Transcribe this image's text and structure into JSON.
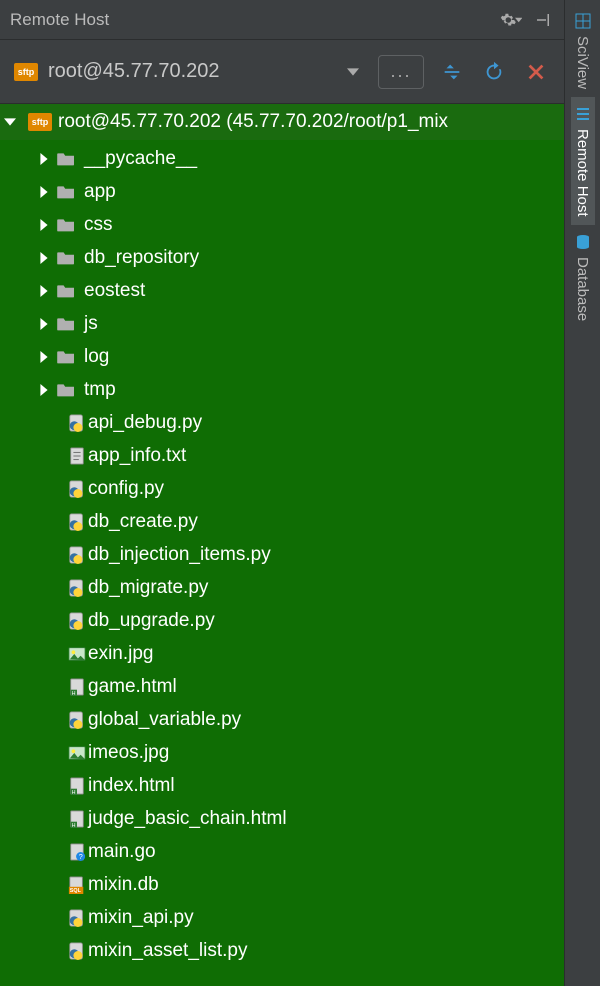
{
  "panel": {
    "title": "Remote Host"
  },
  "connection": {
    "label": "root@45.77.70.202",
    "root_label": "root@45.77.70.202 (45.77.70.202/root/p1_mix"
  },
  "folders": [
    {
      "name": "__pycache__"
    },
    {
      "name": "app"
    },
    {
      "name": "css"
    },
    {
      "name": "db_repository"
    },
    {
      "name": "eostest"
    },
    {
      "name": "js"
    },
    {
      "name": "log"
    },
    {
      "name": "tmp"
    }
  ],
  "files": [
    {
      "name": "api_debug.py",
      "type": "py"
    },
    {
      "name": "app_info.txt",
      "type": "txt"
    },
    {
      "name": "config.py",
      "type": "py"
    },
    {
      "name": "db_create.py",
      "type": "py"
    },
    {
      "name": "db_injection_items.py",
      "type": "py"
    },
    {
      "name": "db_migrate.py",
      "type": "py"
    },
    {
      "name": "db_upgrade.py",
      "type": "py"
    },
    {
      "name": "exin.jpg",
      "type": "img"
    },
    {
      "name": "game.html",
      "type": "html"
    },
    {
      "name": "global_variable.py",
      "type": "py"
    },
    {
      "name": "imeos.jpg",
      "type": "img"
    },
    {
      "name": "index.html",
      "type": "html"
    },
    {
      "name": "judge_basic_chain.html",
      "type": "html"
    },
    {
      "name": "main.go",
      "type": "go"
    },
    {
      "name": "mixin.db",
      "type": "sql"
    },
    {
      "name": "mixin_api.py",
      "type": "py"
    },
    {
      "name": "mixin_asset_list.py",
      "type": "py"
    }
  ],
  "sidebar_tabs": [
    {
      "id": "sciview",
      "label": "SciView",
      "icon": "grid"
    },
    {
      "id": "remotehost",
      "label": "Remote Host",
      "icon": "stripes"
    },
    {
      "id": "database",
      "label": "Database",
      "icon": "db"
    }
  ],
  "colors": {
    "tree_bg": "#0f6d04",
    "tree_header_bg": "#1a6b0f",
    "accent_orange": "#e08700"
  }
}
